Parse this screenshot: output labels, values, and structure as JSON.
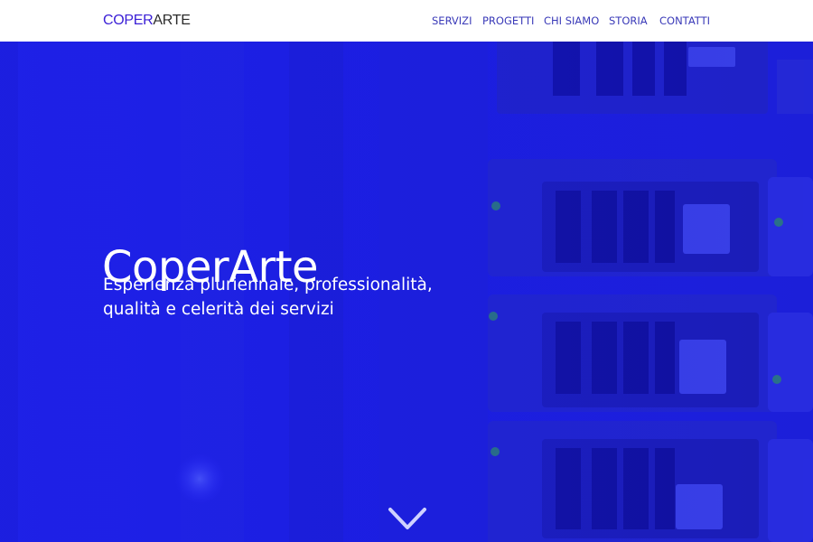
{
  "logo": {
    "part1": "COPER",
    "part2": "ARTE"
  },
  "nav": {
    "items": [
      {
        "label": "SERVIZI"
      },
      {
        "label": "PROGETTI"
      },
      {
        "label": "CHI SIAMO"
      },
      {
        "label": "STORIA"
      },
      {
        "label": "CONTATTI"
      }
    ]
  },
  "hero": {
    "title": "CoperArte",
    "subtitle": "Esperienza pluriennale, professionalità, qualità e celerità dei servizi",
    "background": "server-rack-photo",
    "overlay_color": "#1e1ee0",
    "scroll_icon": "chevron-down-icon"
  },
  "colors": {
    "brand_primary": "#3a1fd6",
    "nav_text": "#3a3ab8",
    "hero_text": "#ffffff"
  }
}
